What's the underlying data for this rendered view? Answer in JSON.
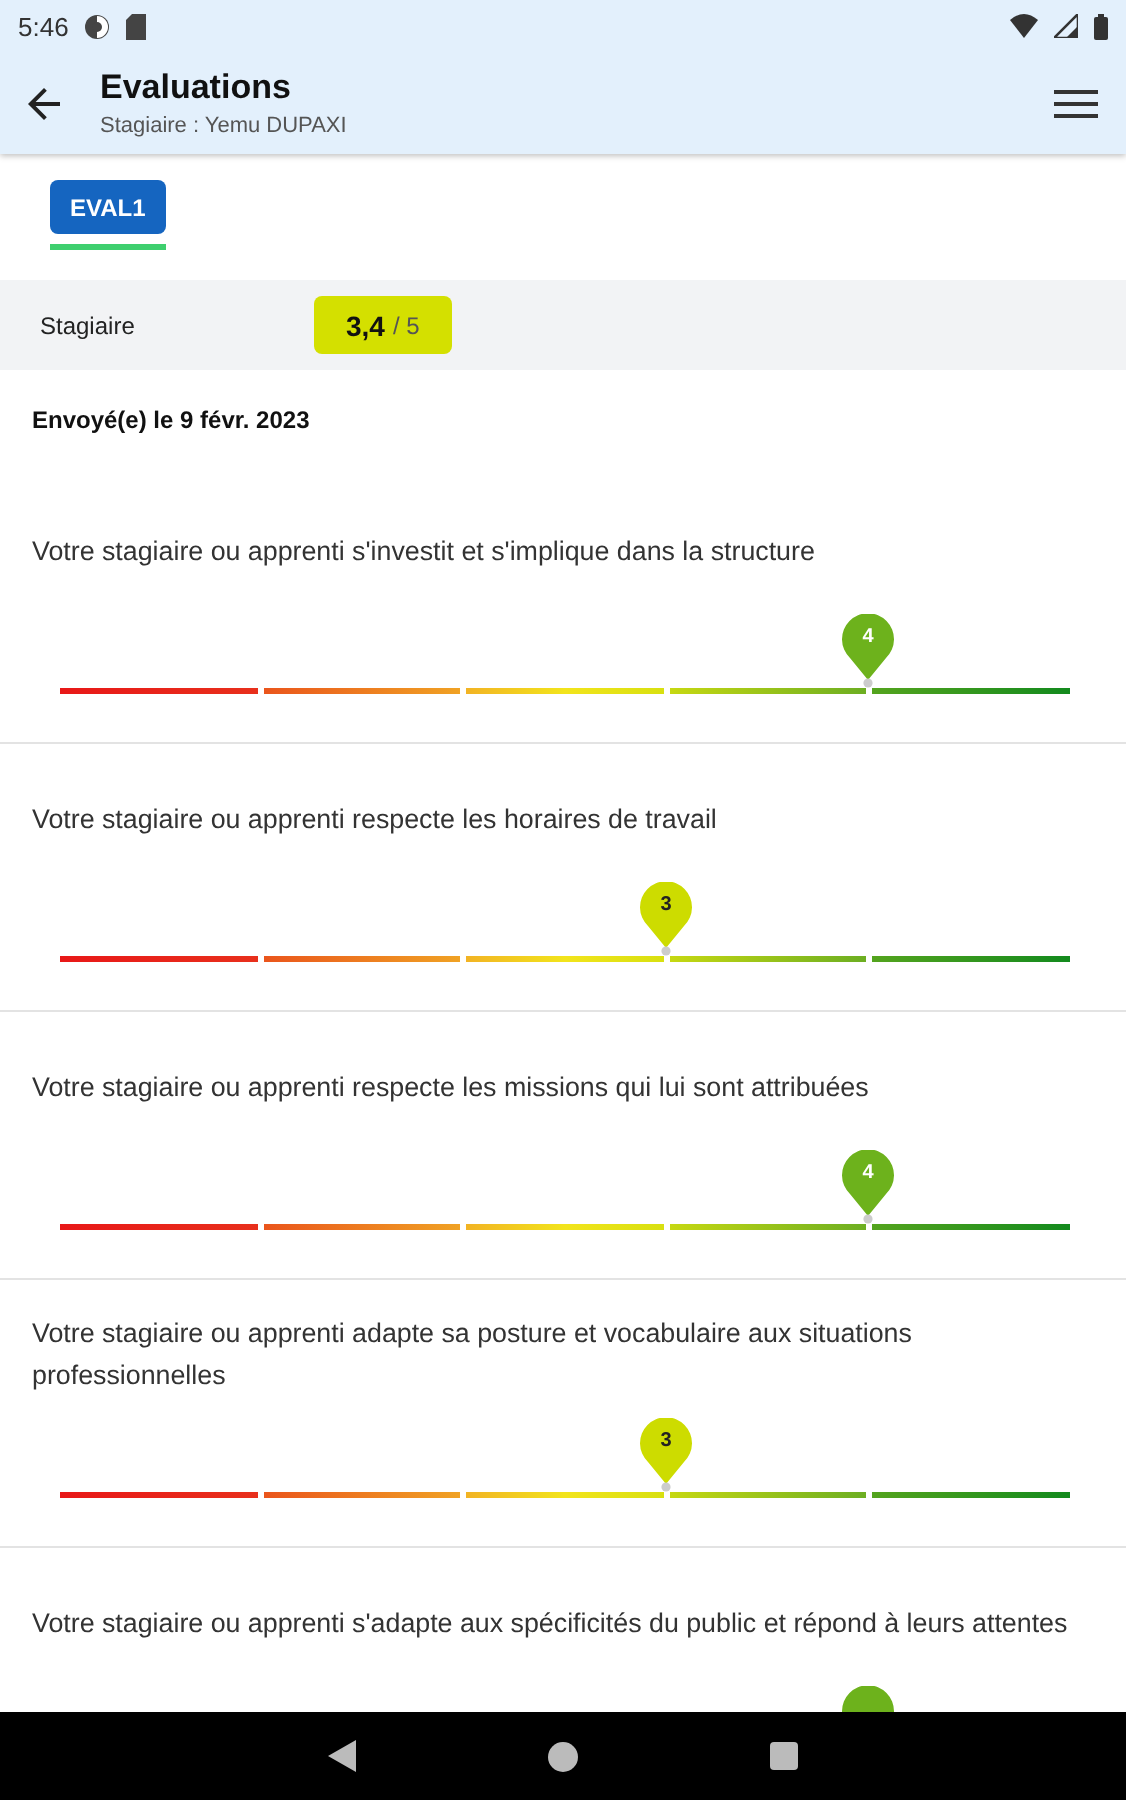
{
  "status_bar": {
    "time": "5:46"
  },
  "header": {
    "title": "Evaluations",
    "subtitle": "Stagiaire : Yemu DUPAXI"
  },
  "tabs": [
    {
      "label": "EVAL1",
      "selected": true
    }
  ],
  "score": {
    "label": "Stagiaire",
    "value": "3,4",
    "max": "/ 5"
  },
  "sent": "Envoyé(e) le 9 févr. 2023",
  "questions": [
    {
      "text": "Votre stagiaire ou apprenti s'investit et s'implique dans la structure",
      "level": 0.8,
      "pin": "4"
    },
    {
      "text": "Votre stagiaire ou apprenti respecte les horaires de travail",
      "level": 0.6,
      "pin": "3"
    },
    {
      "text": "Votre stagiaire ou apprenti respecte les missions qui lui sont attribuées",
      "level": 0.8,
      "pin": "4"
    },
    {
      "text": "Votre stagiaire ou apprenti adapte sa posture et vocabulaire aux situations professionnelles",
      "level": 0.6,
      "pin": "3"
    },
    {
      "text": "Votre stagiaire ou apprenti s'adapte aux spécificités du public et répond à leurs attentes",
      "level": 0.8
    }
  ]
}
